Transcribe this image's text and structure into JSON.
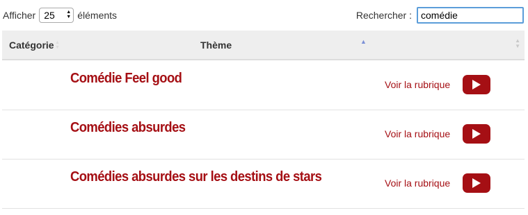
{
  "length_control": {
    "prefix": "Afficher",
    "selected": "25",
    "suffix": "éléments"
  },
  "search": {
    "label": "Rechercher :",
    "value": "comédie"
  },
  "table": {
    "columns": [
      "Catégorie",
      "Thème",
      ""
    ],
    "rows": [
      {
        "title": "Comédie Feel good",
        "link_label": "Voir la rubrique"
      },
      {
        "title": "Comédies absurdes",
        "link_label": "Voir la rubrique"
      },
      {
        "title": "Comédies absurdes sur les destins de stars",
        "link_label": "Voir la rubrique"
      }
    ]
  },
  "icons": {
    "play": "play-icon",
    "sort": "sort-icon"
  },
  "colors": {
    "accent": "#a50f14",
    "header_bg": "#eeeeee",
    "focus_border": "#5b9dd9"
  }
}
